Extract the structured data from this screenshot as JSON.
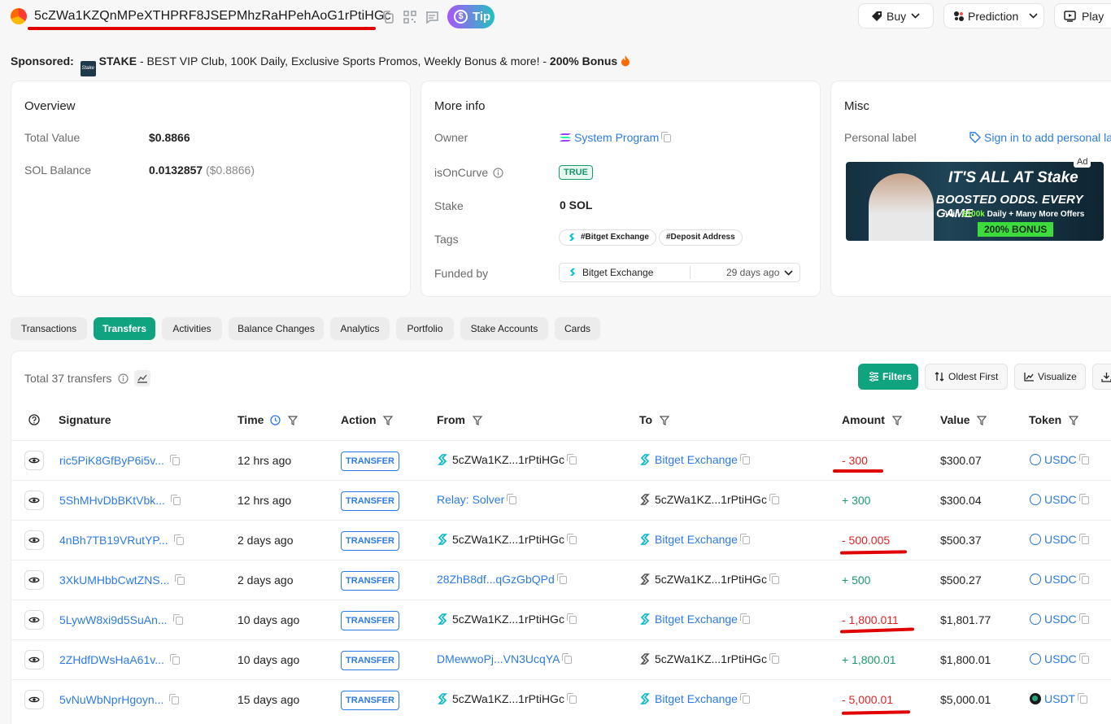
{
  "header": {
    "address": "5cZWa1KZQnMPeXTHPRF8JSEPMhzRaHPehAoG1rPtiHGc",
    "tip_label": "Tip",
    "buy_label": "Buy",
    "prediction_label": "Prediction",
    "play_label": "Play"
  },
  "sponsored": {
    "prefix": "Sponsored:",
    "brand": "STAKE",
    "text": " - BEST VIP Club, 100K Daily, Exclusive Sports Promos, Weekly Bonus & more! - ",
    "bonus": "200% Bonus"
  },
  "overview": {
    "title": "Overview",
    "total_value_label": "Total Value",
    "total_value": "$0.8866",
    "sol_balance_label": "SOL Balance",
    "sol_balance": "0.0132857",
    "sol_balance_usd": "($0.8866)"
  },
  "more_info": {
    "title": "More info",
    "owner_label": "Owner",
    "owner_value": "System Program",
    "oncurve_label": "isOnCurve",
    "oncurve_value": "TRUE",
    "stake_label": "Stake",
    "stake_value": "0 SOL",
    "tags_label": "Tags",
    "tags": [
      "#Bitget Exchange",
      "#Deposit Address"
    ],
    "funded_label": "Funded by",
    "funded_by": "Bitget Exchange",
    "funded_time": "29 days ago"
  },
  "misc": {
    "title": "Misc",
    "personal_label": "Personal label",
    "sign_in_text": "Sign in to add personal la",
    "ad": {
      "ad_label": "Ad",
      "headline": "IT'S ALL AT Stake",
      "line2": "BOOSTED ODDS. EVERY GAME",
      "line3_prefix": "Win ",
      "line3_highlight": "$100k",
      "line3_suffix": " Daily + Many More Offers",
      "bonus": "200% BONUS"
    }
  },
  "tabs": [
    "Transactions",
    "Transfers",
    "Activities",
    "Balance Changes",
    "Analytics",
    "Portfolio",
    "Stake Accounts",
    "Cards"
  ],
  "toolbar": {
    "total": "Total 37 transfers",
    "filters": "Filters",
    "oldest_first": "Oldest First",
    "visualize": "Visualize"
  },
  "columns": [
    "Signature",
    "Time",
    "Action",
    "From",
    "To",
    "Amount",
    "Value",
    "Token"
  ],
  "rows": [
    {
      "signature": "ric5PiK8GfByP6i5v...",
      "time": "12 hrs ago",
      "action": "TRANSFER",
      "from": "5cZWa1KZ...1rPtiHGc",
      "to": "Bitget Exchange",
      "amount": "- 300",
      "value": "$300.07",
      "token": "USDC"
    },
    {
      "signature": "5ShMHvDbBKtVbk...",
      "time": "12 hrs ago",
      "action": "TRANSFER",
      "from": "Relay: Solver",
      "to": "5cZWa1KZ...1rPtiHGc",
      "amount": "+ 300",
      "value": "$300.04",
      "token": "USDC"
    },
    {
      "signature": "4nBh7TB19VRutYP...",
      "time": "2 days ago",
      "action": "TRANSFER",
      "from": "5cZWa1KZ...1rPtiHGc",
      "to": "Bitget Exchange",
      "amount": "- 500.005",
      "value": "$500.37",
      "token": "USDC"
    },
    {
      "signature": "3XkUMHbbCwtZNS...",
      "time": "2 days ago",
      "action": "TRANSFER",
      "from": "28ZhB8df...qGzGbQPd",
      "to": "5cZWa1KZ...1rPtiHGc",
      "amount": "+ 500",
      "value": "$500.27",
      "token": "USDC"
    },
    {
      "signature": "5LywW8xi9d5SuAn...",
      "time": "10 days ago",
      "action": "TRANSFER",
      "from": "5cZWa1KZ...1rPtiHGc",
      "to": "Bitget Exchange",
      "amount": "- 1,800.011",
      "value": "$1,801.77",
      "token": "USDC"
    },
    {
      "signature": "2ZHdfDWsHaA61v...",
      "time": "10 days ago",
      "action": "TRANSFER",
      "from": "DMewwoPj...VN3UcqYA",
      "to": "5cZWa1KZ...1rPtiHGc",
      "amount": "+ 1,800.01",
      "value": "$1,800.01",
      "token": "USDC"
    },
    {
      "signature": "5vNuWbNprHgoyn...",
      "time": "15 days ago",
      "action": "TRANSFER",
      "from": "5cZWa1KZ...1rPtiHGc",
      "to": "Bitget Exchange",
      "amount": "- 5,000.01",
      "value": "$5,000.01",
      "token": "USDT"
    }
  ]
}
